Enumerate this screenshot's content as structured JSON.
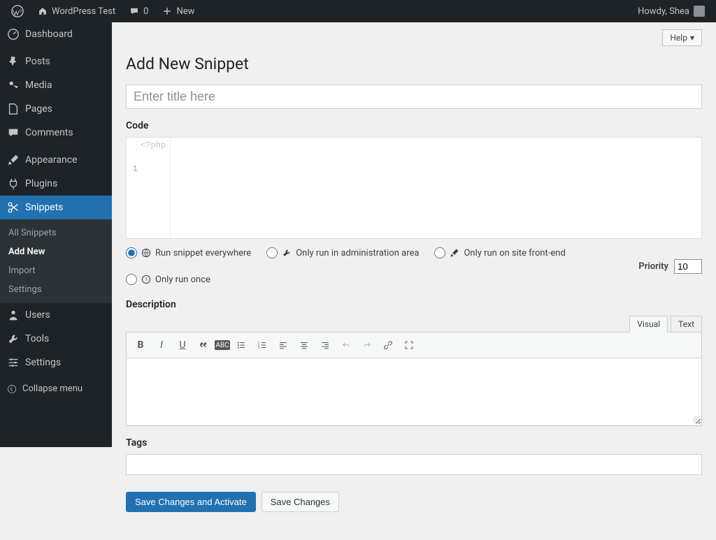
{
  "adminbar": {
    "site_name": "WordPress Test",
    "comments_count": "0",
    "new_label": "New",
    "howdy": "Howdy, Shea"
  },
  "sidebar": {
    "items": [
      {
        "label": "Dashboard"
      },
      {
        "label": "Posts"
      },
      {
        "label": "Media"
      },
      {
        "label": "Pages"
      },
      {
        "label": "Comments"
      },
      {
        "label": "Appearance"
      },
      {
        "label": "Plugins"
      },
      {
        "label": "Snippets"
      },
      {
        "label": "Users"
      },
      {
        "label": "Tools"
      },
      {
        "label": "Settings"
      }
    ],
    "submenu": [
      {
        "label": "All Snippets"
      },
      {
        "label": "Add New"
      },
      {
        "label": "Import"
      },
      {
        "label": "Settings"
      }
    ],
    "collapse_label": "Collapse menu"
  },
  "page": {
    "help_label": "Help",
    "title": "Add New Snippet",
    "title_placeholder": "Enter title here",
    "code_heading": "Code",
    "code_hint": "<?php",
    "line_number": "1",
    "scope": {
      "everywhere": "Run snippet everywhere",
      "admin": "Only run in administration area",
      "frontend": "Only run on site front-end",
      "once": "Only run once"
    },
    "priority_label": "Priority",
    "priority_value": "10",
    "description_heading": "Description",
    "desc_tabs": {
      "visual": "Visual",
      "text": "Text"
    },
    "tags_heading": "Tags",
    "btn_primary": "Save Changes and Activate",
    "btn_secondary": "Save Changes"
  }
}
